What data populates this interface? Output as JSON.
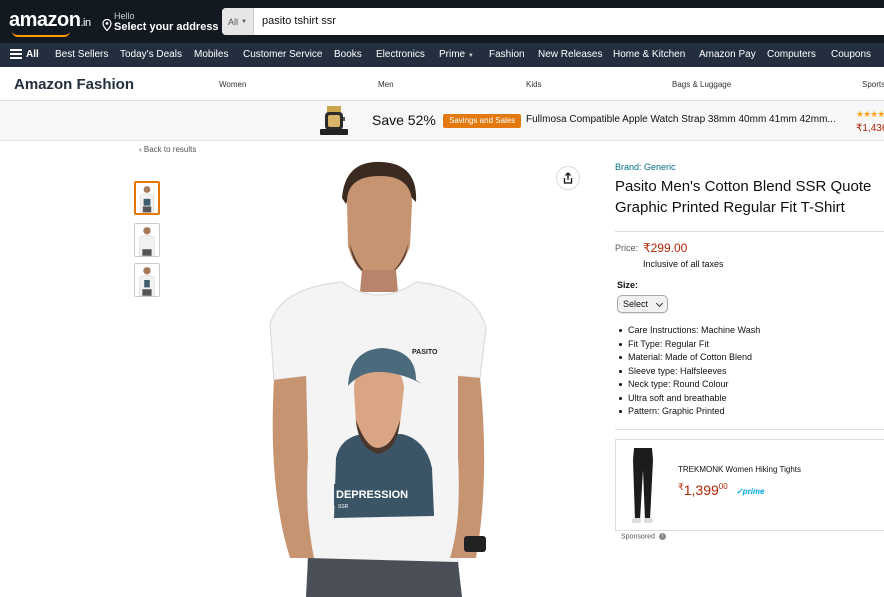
{
  "header": {
    "logo_text": "amazon",
    "logo_suffix": ".in",
    "address_hello": "Hello",
    "address_select": "Select your address",
    "search_category": "All",
    "search_value": "pasito tshirt ssr"
  },
  "nav": {
    "all": "All",
    "items": [
      "Best Sellers",
      "Today's Deals",
      "Mobiles",
      "Customer Service",
      "Books",
      "Electronics",
      "Prime",
      "Fashion",
      "New Releases",
      "Home & Kitchen",
      "Amazon Pay",
      "Computers",
      "Coupons"
    ]
  },
  "store": {
    "title": "Amazon Fashion",
    "links": [
      "Women",
      "Men",
      "Kids",
      "Bags & Luggage",
      "Sports"
    ]
  },
  "promo": {
    "save_text": "Save 52%",
    "badge": "Savings and Sales",
    "title": "Fullmosa Compatible Apple Watch Strap 38mm 40mm 41mm 42mm...",
    "stars": "★★★★",
    "price": "₹1,436",
    "colors": {
      "badge": "#e47911",
      "price": "#b12704"
    }
  },
  "breadcrumb": {
    "back": "‹ Back to results"
  },
  "product": {
    "brand": "Brand: Generic",
    "title_line1": "Pasito Men's Cotton Blend SSR Quote",
    "title_line2": "Graphic Printed Regular Fit T-Shirt",
    "price_label": "Price:",
    "price": "₹299.00",
    "taxes": "Inclusive of all taxes",
    "size_label": "Size:",
    "size_selected": "Select",
    "bullets": [
      "Care Instructions: Machine Wash",
      "Fit Type: Regular Fit",
      "Material: Made of Cotton Blend",
      "Sleeve type: Halfsleeves",
      "Neck type: Round Colour",
      "Ultra soft and breathable",
      "Pattern: Graphic Printed"
    ],
    "print_brand": "PASITO",
    "print_text": "DEPRESSION",
    "print_subtext": "SSR"
  },
  "sponsored": {
    "title": "TREKMONK Women Hiking Tights",
    "price_symbol": "₹",
    "price_whole": "1,399",
    "price_fraction": "00",
    "prime": "✓prime",
    "label": "Sponsored",
    "info": "i"
  }
}
